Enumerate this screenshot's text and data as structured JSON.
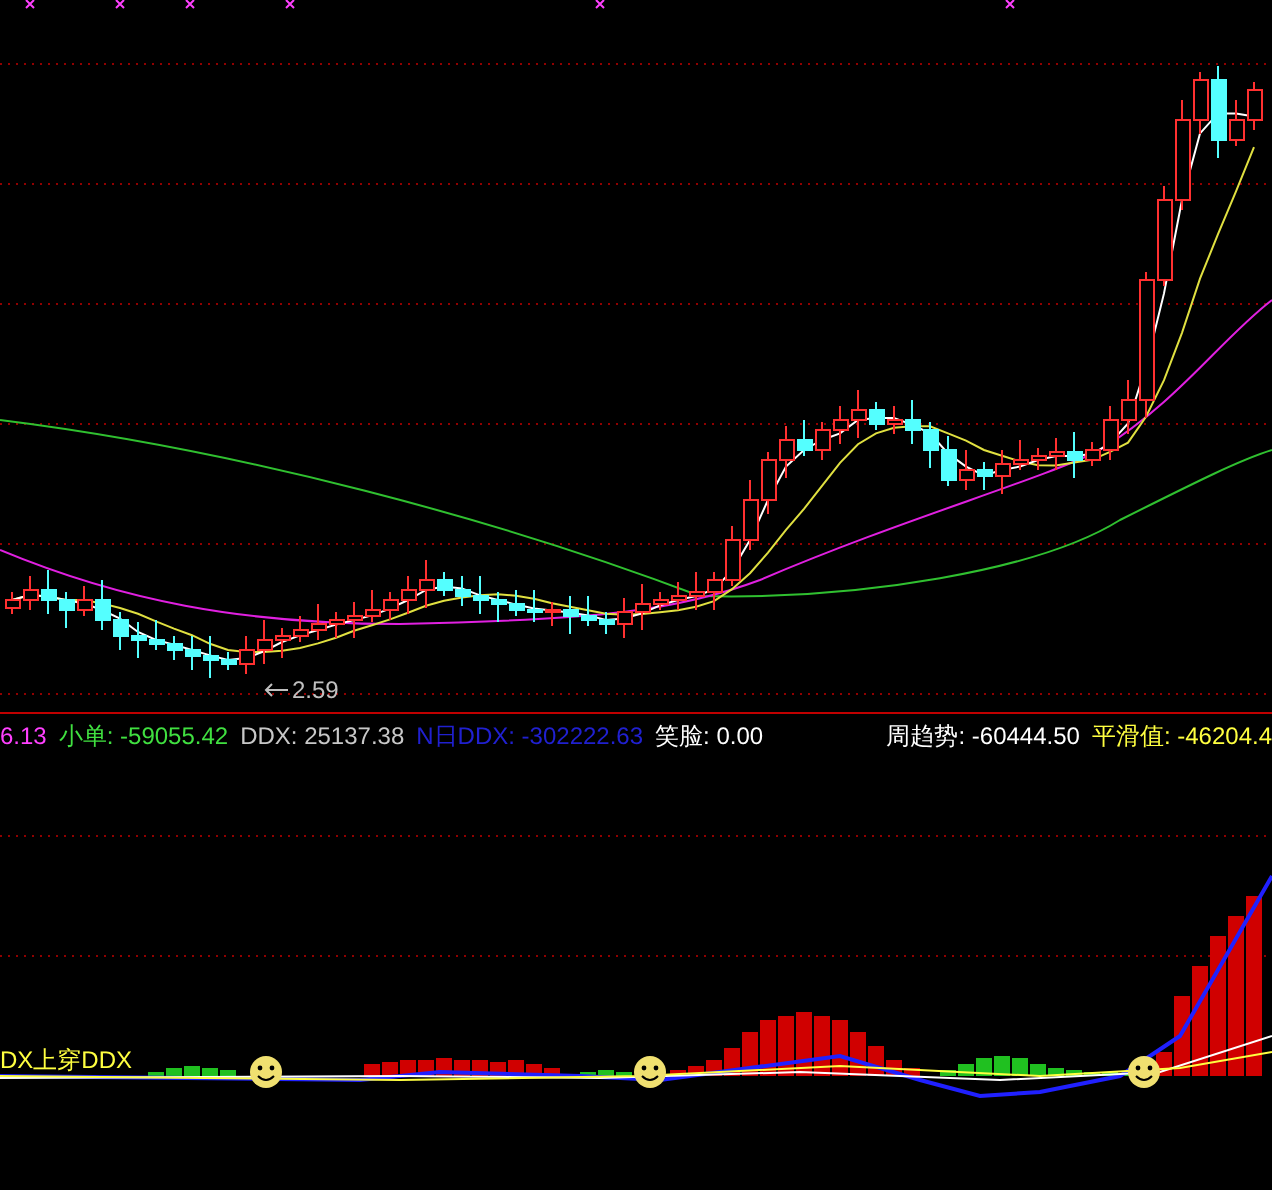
{
  "price_chart": {
    "low_label": "2.59"
  },
  "legend": [
    {
      "text": "6.13",
      "color": "#ff40ff"
    },
    {
      "text": "小单: -59055.42",
      "color": "#40e040"
    },
    {
      "text": "DDX: 25137.38",
      "color": "#c8c8c8"
    },
    {
      "text": "N日DDX: -302222.63",
      "color": "#2020d0"
    },
    {
      "text": "笑脸: 0.00",
      "color": "#ffffff"
    }
  ],
  "legend_right": [
    {
      "text": "周趋势: -60444.50",
      "color": "#ffffff"
    },
    {
      "text": "平滑值: -46204.4",
      "color": "#ffff40"
    }
  ],
  "indicator_pane": {
    "signal_label": "DX上穿DDX"
  }
}
